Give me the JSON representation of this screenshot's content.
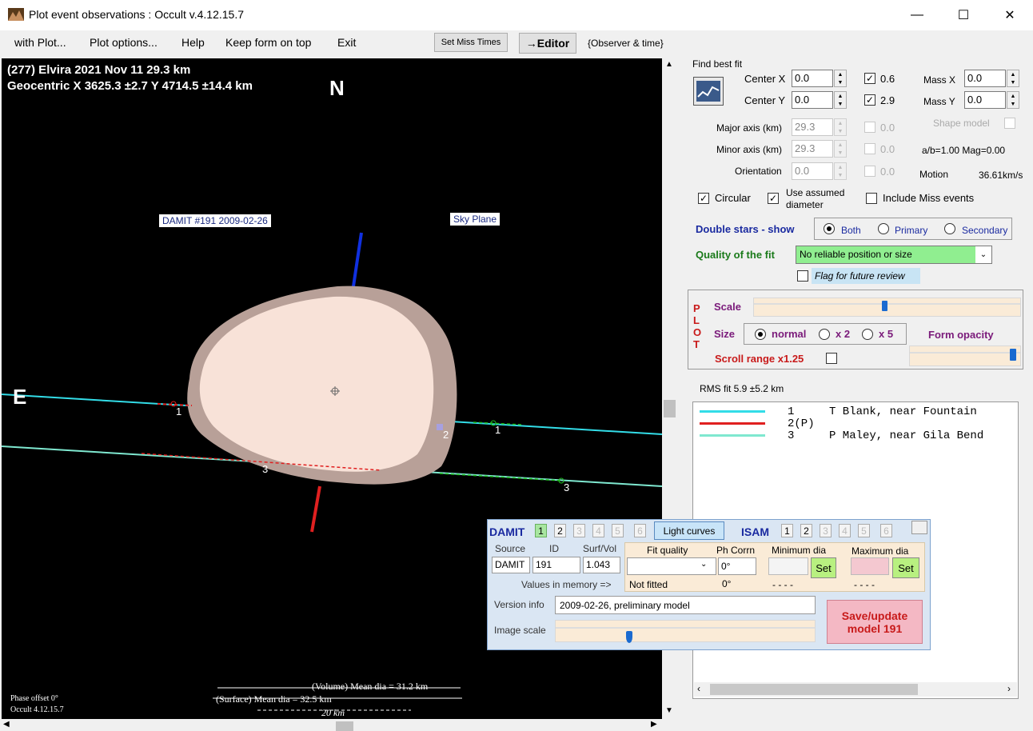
{
  "window": {
    "title": "Plot event observations : Occult v.4.12.15.7",
    "minimize": "—",
    "maximize": "☐",
    "close": "✕"
  },
  "menu": {
    "with_plot": "with Plot...",
    "plot_options": "Plot options...",
    "help": "Help",
    "keep_on_top": "Keep form on top",
    "exit": "Exit",
    "set_miss_times": "Set Miss Times",
    "editor": "→Editor",
    "observer_time": "{Observer & time}"
  },
  "plot": {
    "header1": "(277) Elvira  2021 Nov 11   29.3 km",
    "header2": "Geocentric  X  3625.3 ±2.7  Y 4714.5 ±14.4 km",
    "north": "N",
    "east": "E",
    "damit_label": "DAMIT #191 2009-02-26",
    "sky_plane": "Sky Plane",
    "chord_labels": [
      "1",
      "2",
      "3",
      "1",
      "3"
    ],
    "volume_dia": "(Volume) Mean dia = 31.2 km",
    "surface_dia": "(Surface) Mean dia = 32.5 km",
    "scale_bar": "20 km",
    "phase_offset": "Phase offset 0°",
    "version": "Occult 4.12.15.7"
  },
  "fit": {
    "title": "Find best fit",
    "center_x_label": "Center X",
    "center_x": "0.0",
    "center_y_label": "Center Y",
    "center_y": "0.0",
    "cx_chk": "0.6",
    "cy_chk": "2.9",
    "mass_x_label": "Mass X",
    "mass_x": "0.0",
    "mass_y_label": "Mass Y",
    "mass_y": "0.0",
    "major_label": "Major axis (km)",
    "major": "29.3",
    "minor_label": "Minor axis (km)",
    "minor": "29.3",
    "orient_label": "Orientation",
    "orient": "0.0",
    "dis1": "0.0",
    "dis2": "0.0",
    "dis3": "0.0",
    "shape_model": "Shape model",
    "ab_mag": "a/b=1.00  Mag=0.00",
    "motion_label": "Motion",
    "motion": "36.61km/s",
    "circular": "Circular",
    "use_assumed": "Use assumed",
    "diameter": "diameter",
    "include_miss": "Include Miss events"
  },
  "double_stars": {
    "label": "Double stars - show",
    "both": "Both",
    "primary": "Primary",
    "secondary": "Secondary"
  },
  "quality": {
    "label": "Quality of the fit",
    "value": "No reliable position or size",
    "flag": "Flag for future review"
  },
  "plot_group": {
    "letters": [
      "P",
      "L",
      "O",
      "T"
    ],
    "scale": "Scale",
    "scale_level": 0.49,
    "size": "Size",
    "normal": "normal",
    "x2": "x 2",
    "x5": "x 5",
    "form_opacity": "Form opacity",
    "opacity_level": 0.96,
    "scroll_range": "Scroll range x1.25"
  },
  "rms": "RMS fit 5.9 ±5.2 km",
  "observers": [
    {
      "num": "1",
      "name": "T Blank, near Fountain",
      "color": "#33dde8"
    },
    {
      "num": "2(P)",
      "name": "",
      "color": "#e02020"
    },
    {
      "num": "3",
      "name": "P Maley, near Gila Bend",
      "color": "#7fe8d0"
    }
  ],
  "damit": {
    "label": "DAMIT",
    "nums": [
      "1",
      "2",
      "3",
      "4",
      "5",
      "6"
    ],
    "light_curves": "Light curves",
    "isam": "ISAM",
    "isam_nums": [
      "1",
      "2",
      "3",
      "4",
      "5",
      "6"
    ],
    "source_label": "Source",
    "id_label": "ID",
    "surf_label": "Surf/Vol",
    "source": "DAMIT",
    "id": "191",
    "surf": "1.043",
    "fit_quality_label": "Fit quality",
    "ph_corrn_label": "Ph Corrn",
    "ph_corrn": "0°",
    "min_dia_label": "Minimum dia",
    "max_dia_label": "Maximum dia",
    "set": "Set",
    "values_memory": "Values in memory =>",
    "not_fitted": "Not fitted",
    "mem_ph": "0°",
    "mem_min": "- - - -",
    "mem_max": "- - - -",
    "version_label": "Version info",
    "version": "2009-02-26, preliminary model",
    "image_scale": "Image scale",
    "image_scale_level": 0.28,
    "save": "Save/update",
    "save2": "model 191"
  }
}
